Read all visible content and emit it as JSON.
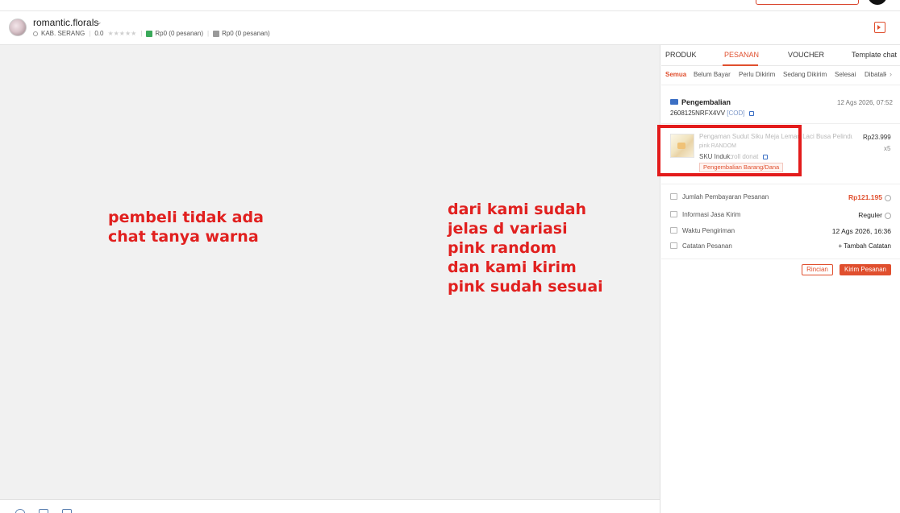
{
  "header": {
    "shop_name": "romantic.florals",
    "caret": "⌄",
    "location": "KAB. SERANG",
    "rating": "0.0",
    "stars": "★★★★★",
    "stat_paid": "Rp0 (0 pesanan)",
    "stat_unpaid": "Rp0 (0 pesanan)"
  },
  "chat": {
    "note_left": "pembeli tidak ada\nchat tanya warna",
    "note_right": "dari kami sudah\njelas d variasi\npink random\ndan kami kirim\npink sudah sesuai",
    "note_color": "#e1201f"
  },
  "panel": {
    "tabs": [
      "PRODUK",
      "PESANAN",
      "VOUCHER",
      "Template chat"
    ],
    "active_tab": "PESANAN",
    "subtabs": [
      "Semua",
      "Belum Bayar",
      "Perlu Dikirim",
      "Sedang Dikirim",
      "Selesai",
      "Dibatalkan"
    ],
    "active_subtab": "Semua",
    "subtab_arrow": "›",
    "order": {
      "type": "Pengembalian",
      "date": "12 Ags 2026, 07:52",
      "number": "2608125NRFX4VV",
      "payment_tag": "[COD]",
      "product_name": "Pengaman Sudut Siku Meja Lemari Laci Busa Pelindung",
      "variant": "pink RANDOM",
      "sku_label": "SKU Induk:",
      "sku_value": "roll donat",
      "price": "Rp23.999",
      "qty": "x5",
      "return_badge": "Pengembalian Barang/Dana",
      "rows": [
        {
          "label": "Jumlah Pembayaran Pesanan",
          "value": "Rp121.195"
        },
        {
          "label": "Informasi Jasa Kirim",
          "value": "Reguler"
        },
        {
          "label": "Waktu Pengiriman",
          "value": "12 Ags 2026, 16:36"
        },
        {
          "label": "Catatan Pesanan",
          "value": "+ Tambah Catatan"
        }
      ],
      "btn_details": "Rincian",
      "btn_send": "Kirim Pesanan"
    }
  },
  "accent_color": "#e04f2e",
  "icons": [
    "location-icon",
    "star-icon",
    "wallet-icon",
    "bag-icon",
    "panel-toggle-icon",
    "truck-icon",
    "link-icon",
    "info-icon",
    "emoji-icon",
    "image-icon",
    "attach-icon"
  ]
}
